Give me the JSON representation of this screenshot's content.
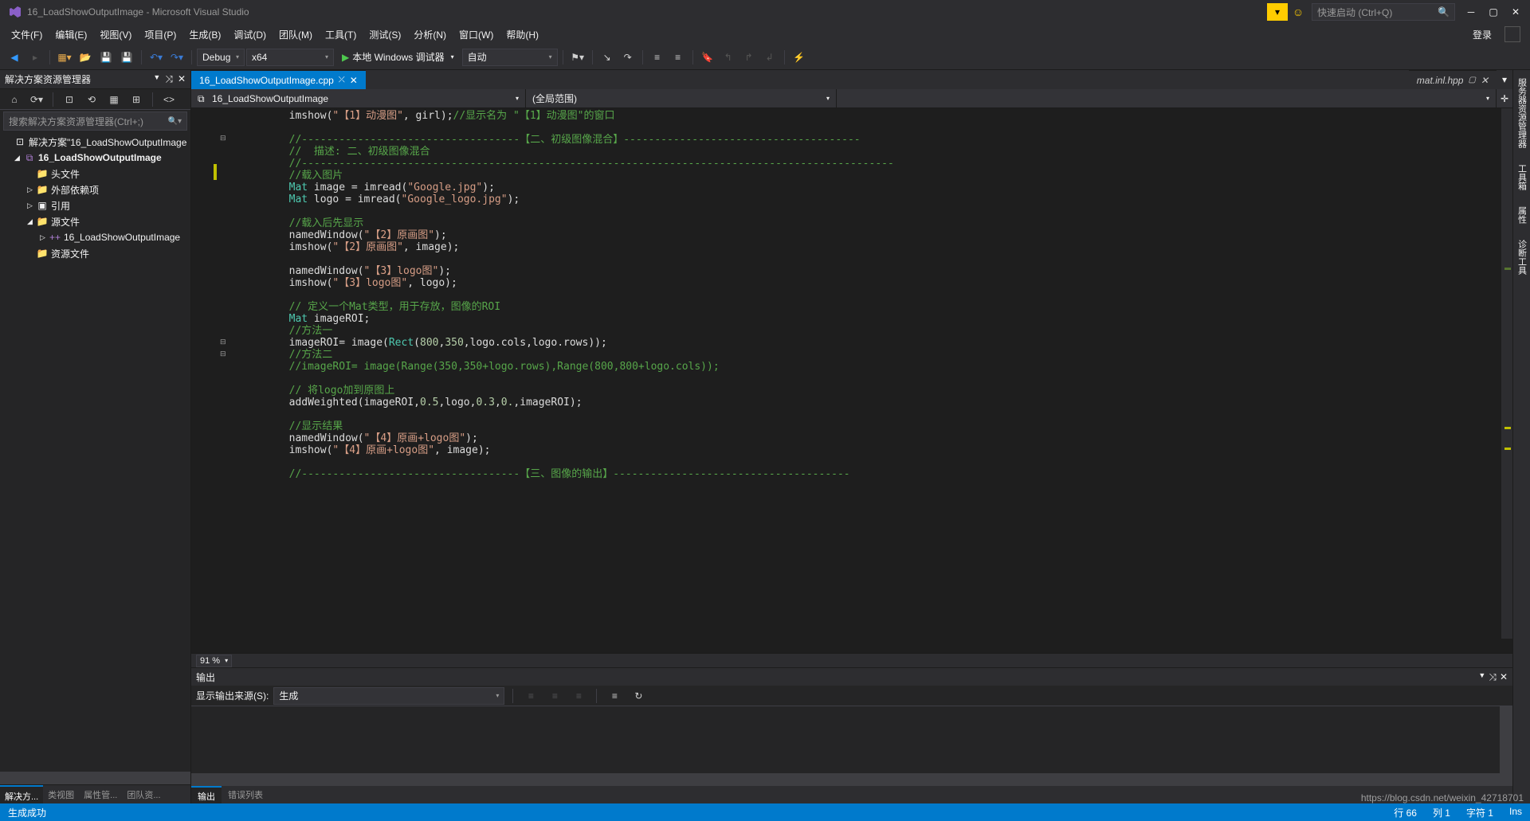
{
  "title": "16_LoadShowOutputImage - Microsoft Visual Studio",
  "quick_launch": "快速启动 (Ctrl+Q)",
  "menu": [
    "文件(F)",
    "编辑(E)",
    "视图(V)",
    "项目(P)",
    "生成(B)",
    "调试(D)",
    "团队(M)",
    "工具(T)",
    "测试(S)",
    "分析(N)",
    "窗口(W)",
    "帮助(H)"
  ],
  "login": "登录",
  "toolbar": {
    "config": "Debug",
    "platform": "x64",
    "run": "本地 Windows 调试器",
    "auto": "自动"
  },
  "solution_explorer": {
    "title": "解决方案资源管理器",
    "search_placeholder": "搜索解决方案资源管理器(Ctrl+;)",
    "root": "解决方案\"16_LoadShowOutputImage",
    "project": "16_LoadShowOutputImage",
    "folders": {
      "headers": "头文件",
      "external": "外部依赖项",
      "refs": "引用",
      "sources": "源文件",
      "resources": "资源文件"
    },
    "source_file": "16_LoadShowOutputImage",
    "tabs": [
      "解决方...",
      "类视图",
      "属性管...",
      "团队资..."
    ]
  },
  "editor": {
    "active_tab": "16_LoadShowOutputImage.cpp",
    "preview_tab": "mat.inl.hpp",
    "nav_left": "16_LoadShowOutputImage",
    "nav_right": "(全局范围)",
    "zoom": "91 %"
  },
  "code": {
    "lines": [
      {
        "indent": 2,
        "parts": [
          {
            "t": "p",
            "v": "imshow("
          },
          {
            "t": "s",
            "v": "\"【1】动漫图\""
          },
          {
            "t": "p",
            "v": ", girl);"
          },
          {
            "t": "c",
            "v": "//显示名为 \"【1】动漫图\"的窗口"
          }
        ]
      },
      {
        "indent": 2,
        "parts": [
          {
            "t": "p",
            "v": ""
          }
        ]
      },
      {
        "indent": 2,
        "parts": [
          {
            "t": "c",
            "v": "//-----------------------------------【二、初级图像混合】--------------------------------------"
          }
        ]
      },
      {
        "indent": 2,
        "parts": [
          {
            "t": "c",
            "v": "//  描述: 二、初级图像混合"
          }
        ]
      },
      {
        "indent": 2,
        "parts": [
          {
            "t": "c",
            "v": "//-----------------------------------------------------------------------------------------------"
          }
        ]
      },
      {
        "indent": 2,
        "parts": [
          {
            "t": "c",
            "v": "//载入图片"
          }
        ]
      },
      {
        "indent": 2,
        "parts": [
          {
            "t": "t",
            "v": "Mat"
          },
          {
            "t": "p",
            "v": " image = imread("
          },
          {
            "t": "s",
            "v": "\"Google.jpg\""
          },
          {
            "t": "p",
            "v": ");"
          }
        ]
      },
      {
        "indent": 2,
        "parts": [
          {
            "t": "t",
            "v": "Mat"
          },
          {
            "t": "p",
            "v": " logo = imread("
          },
          {
            "t": "s",
            "v": "\"Google_logo.jpg\""
          },
          {
            "t": "p",
            "v": ");"
          }
        ]
      },
      {
        "indent": 2,
        "parts": [
          {
            "t": "p",
            "v": ""
          }
        ]
      },
      {
        "indent": 2,
        "parts": [
          {
            "t": "c",
            "v": "//载入后先显示"
          }
        ]
      },
      {
        "indent": 2,
        "parts": [
          {
            "t": "p",
            "v": "namedWindow("
          },
          {
            "t": "s",
            "v": "\"【2】原画图\""
          },
          {
            "t": "p",
            "v": ");"
          }
        ]
      },
      {
        "indent": 2,
        "parts": [
          {
            "t": "p",
            "v": "imshow("
          },
          {
            "t": "s",
            "v": "\"【2】原画图\""
          },
          {
            "t": "p",
            "v": ", image);"
          }
        ]
      },
      {
        "indent": 2,
        "parts": [
          {
            "t": "p",
            "v": ""
          }
        ]
      },
      {
        "indent": 2,
        "parts": [
          {
            "t": "p",
            "v": "namedWindow("
          },
          {
            "t": "s",
            "v": "\"【3】logo图\""
          },
          {
            "t": "p",
            "v": ");"
          }
        ]
      },
      {
        "indent": 2,
        "parts": [
          {
            "t": "p",
            "v": "imshow("
          },
          {
            "t": "s",
            "v": "\"【3】logo图\""
          },
          {
            "t": "p",
            "v": ", logo);"
          }
        ]
      },
      {
        "indent": 2,
        "parts": [
          {
            "t": "p",
            "v": ""
          }
        ]
      },
      {
        "indent": 2,
        "parts": [
          {
            "t": "c",
            "v": "// 定义一个Mat类型，用于存放，图像的ROI"
          }
        ]
      },
      {
        "indent": 2,
        "parts": [
          {
            "t": "t",
            "v": "Mat"
          },
          {
            "t": "p",
            "v": " imageROI;"
          }
        ]
      },
      {
        "indent": 2,
        "parts": [
          {
            "t": "c",
            "v": "//方法一"
          }
        ]
      },
      {
        "indent": 2,
        "parts": [
          {
            "t": "p",
            "v": "imageROI= image("
          },
          {
            "t": "t",
            "v": "Rect"
          },
          {
            "t": "p",
            "v": "("
          },
          {
            "t": "n",
            "v": "800"
          },
          {
            "t": "p",
            "v": ","
          },
          {
            "t": "n",
            "v": "350"
          },
          {
            "t": "p",
            "v": ",logo.cols,logo.rows));"
          }
        ]
      },
      {
        "indent": 2,
        "parts": [
          {
            "t": "c",
            "v": "//方法二"
          }
        ]
      },
      {
        "indent": 2,
        "parts": [
          {
            "t": "c",
            "v": "//imageROI= image(Range(350,350+logo.rows),Range(800,800+logo.cols));"
          }
        ]
      },
      {
        "indent": 2,
        "parts": [
          {
            "t": "p",
            "v": ""
          }
        ]
      },
      {
        "indent": 2,
        "parts": [
          {
            "t": "c",
            "v": "// 将logo加到原图上"
          }
        ]
      },
      {
        "indent": 2,
        "parts": [
          {
            "t": "p",
            "v": "addWeighted(imageROI,"
          },
          {
            "t": "n",
            "v": "0.5"
          },
          {
            "t": "p",
            "v": ",logo,"
          },
          {
            "t": "n",
            "v": "0.3"
          },
          {
            "t": "p",
            "v": ","
          },
          {
            "t": "n",
            "v": "0."
          },
          {
            "t": "p",
            "v": ",imageROI);"
          }
        ]
      },
      {
        "indent": 2,
        "parts": [
          {
            "t": "p",
            "v": ""
          }
        ]
      },
      {
        "indent": 2,
        "parts": [
          {
            "t": "c",
            "v": "//显示结果"
          }
        ]
      },
      {
        "indent": 2,
        "parts": [
          {
            "t": "p",
            "v": "namedWindow("
          },
          {
            "t": "s",
            "v": "\"【4】原画+logo图\""
          },
          {
            "t": "p",
            "v": ");"
          }
        ]
      },
      {
        "indent": 2,
        "parts": [
          {
            "t": "p",
            "v": "imshow("
          },
          {
            "t": "s",
            "v": "\"【4】原画+logo图\""
          },
          {
            "t": "p",
            "v": ", image);"
          }
        ]
      },
      {
        "indent": 2,
        "parts": [
          {
            "t": "p",
            "v": ""
          }
        ]
      },
      {
        "indent": 2,
        "parts": [
          {
            "t": "c",
            "v": "//-----------------------------------【三、图像的输出】--------------------------------------"
          }
        ]
      }
    ]
  },
  "output": {
    "title": "输出",
    "source_label": "显示输出来源(S):",
    "source_value": "生成",
    "tabs": [
      "输出",
      "错误列表"
    ]
  },
  "right_rail": [
    "服务器资源管理器",
    "工具箱",
    "属性",
    "诊断工具"
  ],
  "status": {
    "left": "生成成功",
    "line": "行 66",
    "col": "列 1",
    "char": "字符 1",
    "ins": "Ins"
  },
  "watermark": "https://blog.csdn.net/weixin_42718701"
}
